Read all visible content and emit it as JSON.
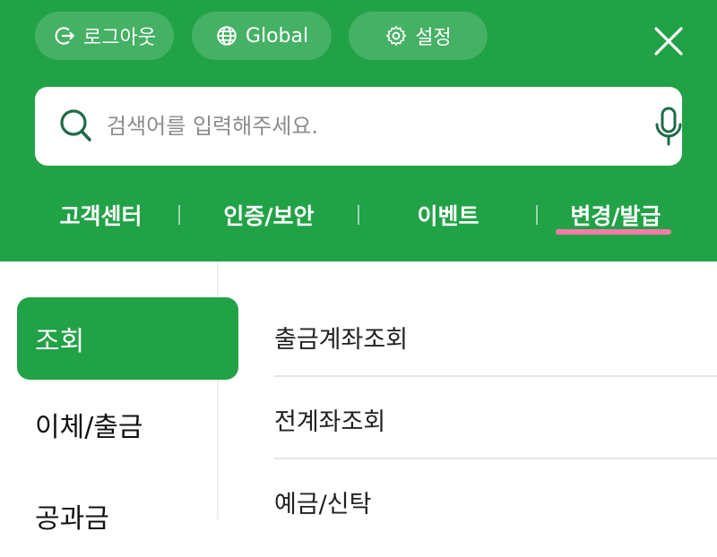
{
  "header": {
    "pills": {
      "logout": "로그아웃",
      "global": "Global",
      "settings": "설정"
    },
    "close_icon": "close-icon"
  },
  "search": {
    "placeholder": "검색어를 입력해주세요.",
    "value": ""
  },
  "quick_links": [
    "고객센터",
    "인증/보안",
    "이벤트",
    "변경/발급"
  ],
  "left_nav": [
    "조회",
    "이체/출금",
    "공과금"
  ],
  "sub_menu": [
    "출금계좌조회",
    "전계좌조회",
    "예금/신탁"
  ],
  "colors": {
    "brand_green": "#22a247",
    "active_underline": "#ff7aa8"
  }
}
